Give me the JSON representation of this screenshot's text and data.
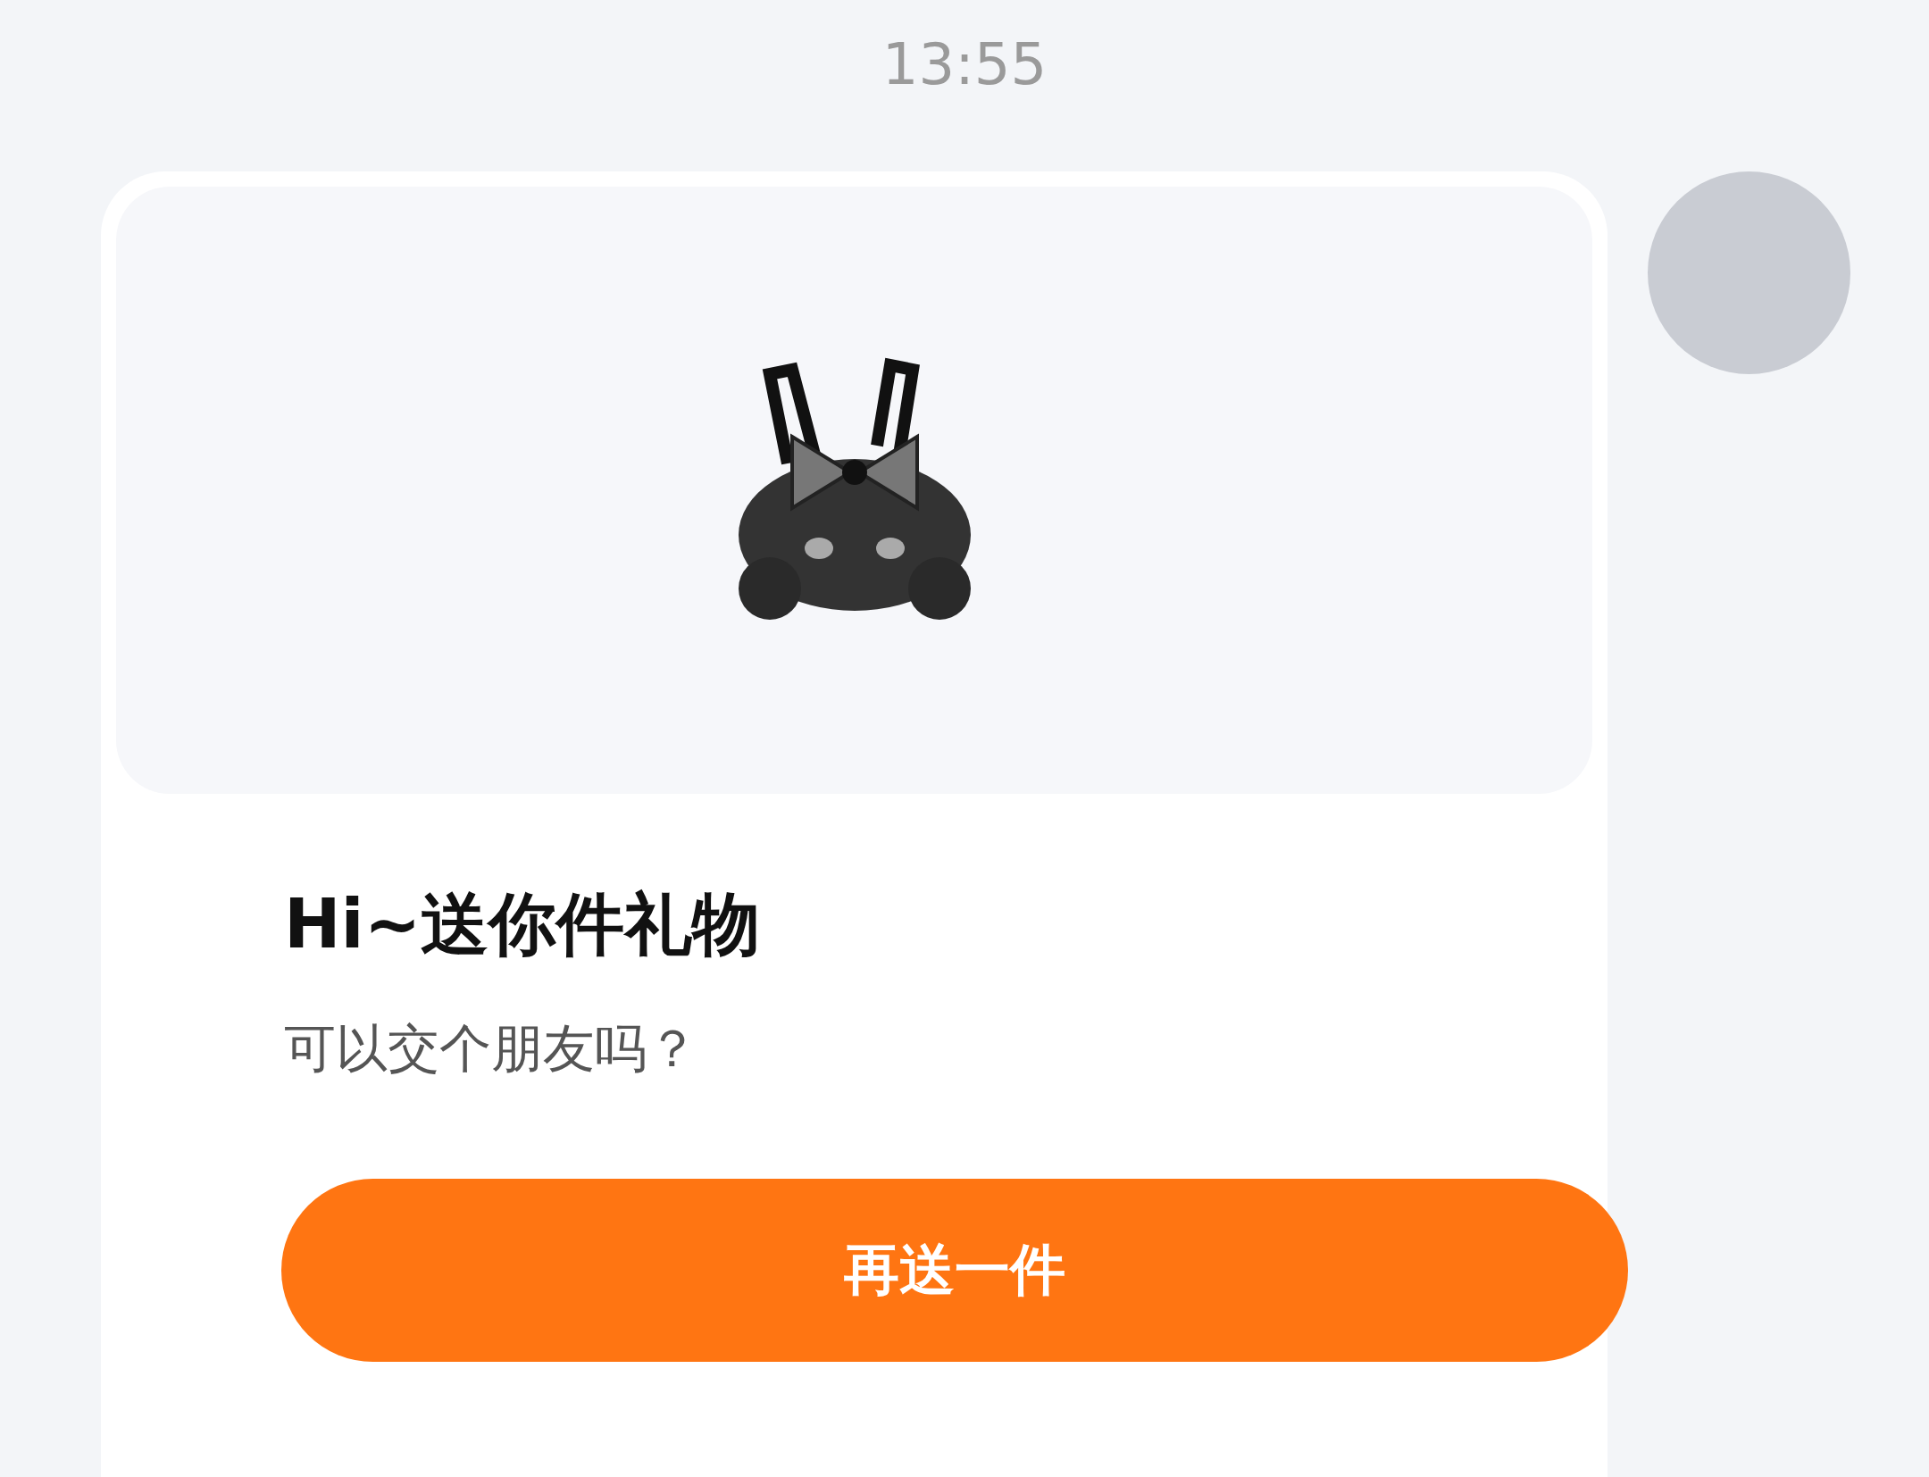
{
  "timestamp": "13:55",
  "gift_card": {
    "title": "Hi~送你件礼物",
    "message": "可以交个朋友吗？",
    "button": "再送一件"
  }
}
